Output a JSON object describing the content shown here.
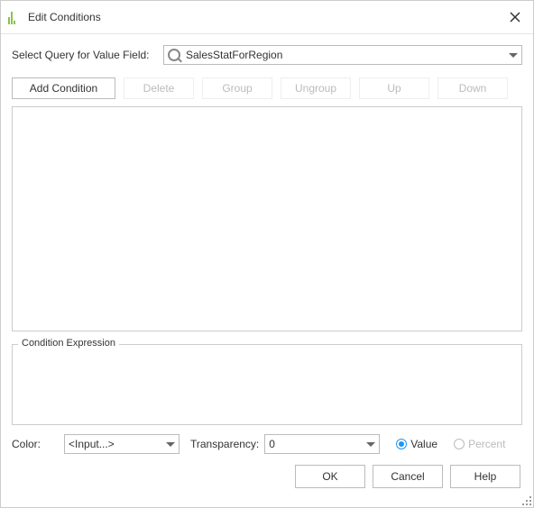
{
  "title": "Edit Conditions",
  "query": {
    "label": "Select Query for Value Field:",
    "value": "SalesStatForRegion"
  },
  "toolbar": {
    "add": "Add Condition",
    "delete": "Delete",
    "group": "Group",
    "ungroup": "Ungroup",
    "up": "Up",
    "down": "Down"
  },
  "expression": {
    "legend": "Condition Expression"
  },
  "color": {
    "label": "Color:",
    "value": "<Input...>"
  },
  "transparency": {
    "label": "Transparency:",
    "value": "0"
  },
  "mode": {
    "value": "Value",
    "percent": "Percent"
  },
  "footer": {
    "ok": "OK",
    "cancel": "Cancel",
    "help": "Help"
  }
}
